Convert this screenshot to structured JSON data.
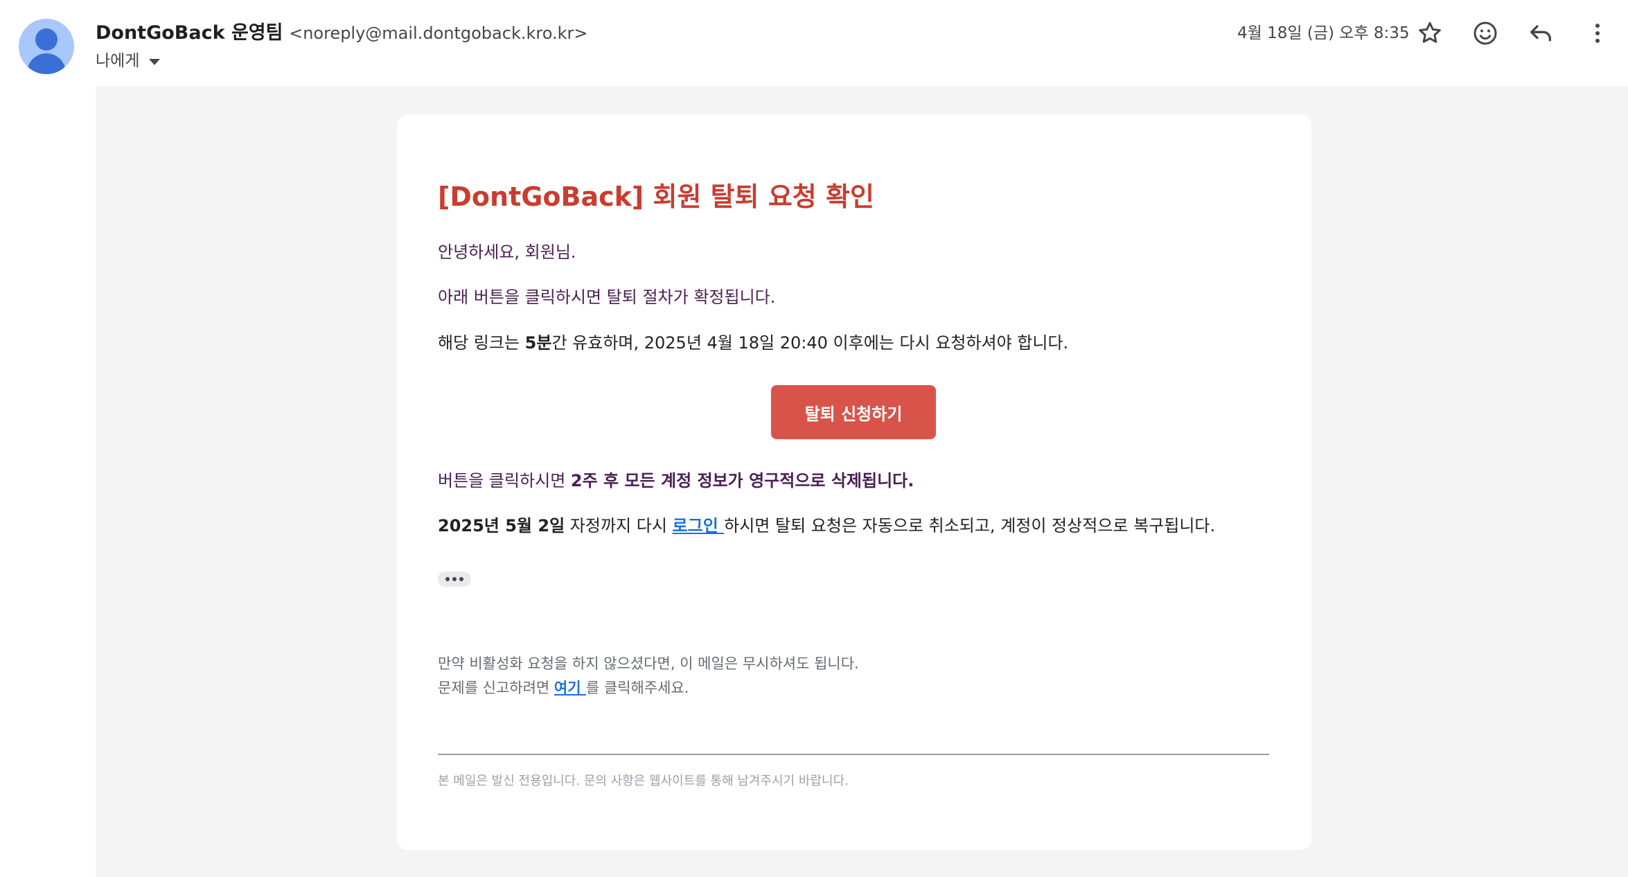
{
  "header": {
    "sender_name": "DontGoBack 운영팀",
    "sender_email": "<noreply@mail.dontgoback.kro.kr>",
    "recipient_label": "나에게",
    "date": "4월 18일 (금) 오후 8:35"
  },
  "email": {
    "title": "[DontGoBack] 회원 탈퇴 요청 확인",
    "greeting": "안녕하세요, 회원님.",
    "instruction": "아래 버튼을 클릭하시면 탈퇴 절차가 확정됩니다.",
    "validity_prefix": "해당 링크는 ",
    "validity_bold": "5분",
    "validity_suffix": "간 유효하며, 2025년 4월 18일 20:40 이후에는 다시 요청하셔야 합니다.",
    "cta_label": "탈퇴 신청하기",
    "warning_prefix": "버튼을 클릭하시면 ",
    "warning_bold": "2주 후 모든 계정 정보가 영구적으로 삭제됩니다.",
    "restore_bold": "2025년 5월 2일",
    "restore_mid": " 자정까지 다시 ",
    "restore_link": "로그인 ",
    "restore_suffix": "하시면 탈퇴 요청은 자동으로 취소되고, 계정이 정상적으로 복구됩니다.",
    "ignore_text": "만약 비활성화 요청을 하지 않으셨다면, 이 메일은 무시하셔도 됩니다.",
    "report_prefix": "문제를 신고하려면 ",
    "report_link": "여기 ",
    "report_suffix": "를 클릭해주세요.",
    "footer_note": "본 메일은 발신 전용입니다. 문의 사항은 웹사이트를 통해 남겨주시기 바랍니다."
  },
  "icons": {
    "star": "star-icon",
    "emoji": "emoji-icon",
    "reply": "reply-icon",
    "more": "more-vert-icon"
  },
  "colors": {
    "title": "#c93d2f",
    "cta": "#d8544a",
    "link": "#1a6fe0",
    "body_purple": "#4a1f53"
  }
}
